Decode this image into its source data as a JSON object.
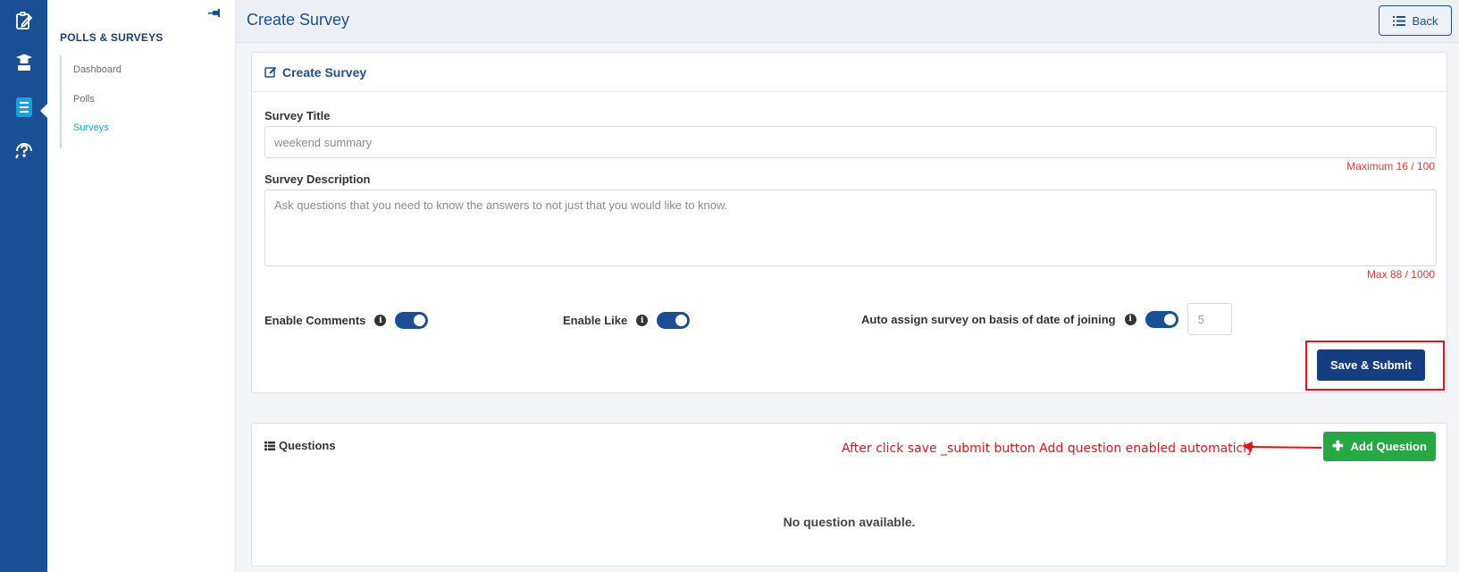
{
  "rail": {
    "items": [
      {
        "icon": "clipboard-edit-icon",
        "active": false
      },
      {
        "icon": "graduation-podium-icon",
        "active": false
      },
      {
        "icon": "survey-list-icon",
        "active": true
      },
      {
        "icon": "support-question-icon",
        "active": false
      }
    ]
  },
  "sidebar": {
    "title": "POLLS & SURVEYS",
    "items": [
      {
        "label": "Dashboard",
        "active": false
      },
      {
        "label": "Polls",
        "active": false
      },
      {
        "label": "Surveys",
        "active": true
      }
    ]
  },
  "header": {
    "title": "Create Survey",
    "back_label": "Back"
  },
  "form": {
    "card_title": "Create Survey",
    "survey_title_label": "Survey Title",
    "survey_title_value": "weekend summary",
    "survey_title_counter": "Maximum 16 / 100",
    "description_label": "Survey Description",
    "description_value": "Ask questions that you need to know the answers to not just that you would like to know.",
    "description_counter": "Max 88 / 1000",
    "enable_comments_label": "Enable Comments",
    "enable_comments_on": true,
    "enable_like_label": "Enable Like",
    "enable_like_on": true,
    "auto_assign_label": "Auto assign survey on basis of date of joining",
    "auto_assign_on": true,
    "auto_assign_days": "5",
    "save_label": "Save & Submit"
  },
  "questions": {
    "title": "Questions",
    "annotation": "After click save _submit button Add question enabled automaticly",
    "add_label": "Add Question",
    "empty_text": "No question available."
  },
  "colors": {
    "rail": "#1a4f95",
    "primary": "#1a4f95",
    "save_button": "#143e7f",
    "add_button": "#27a844",
    "annotation": "#e8111c",
    "counter": "#e53935",
    "active_link": "#1aa0dd"
  }
}
